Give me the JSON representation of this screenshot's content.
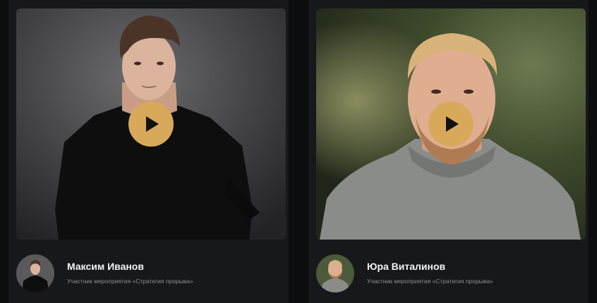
{
  "cards": [
    {
      "name": "Максим Иванов",
      "subtitle": "Участник мероприятия «Стратегия прорыва»"
    },
    {
      "name": "Юра Виталинов",
      "subtitle": "Участник мероприятия «Стратегия прорыва»"
    }
  ],
  "colors": {
    "play_button": "#d9a95b",
    "card_background": "#17181b",
    "page_background": "#0c0d0f"
  },
  "icons": {
    "play": "play-icon"
  }
}
